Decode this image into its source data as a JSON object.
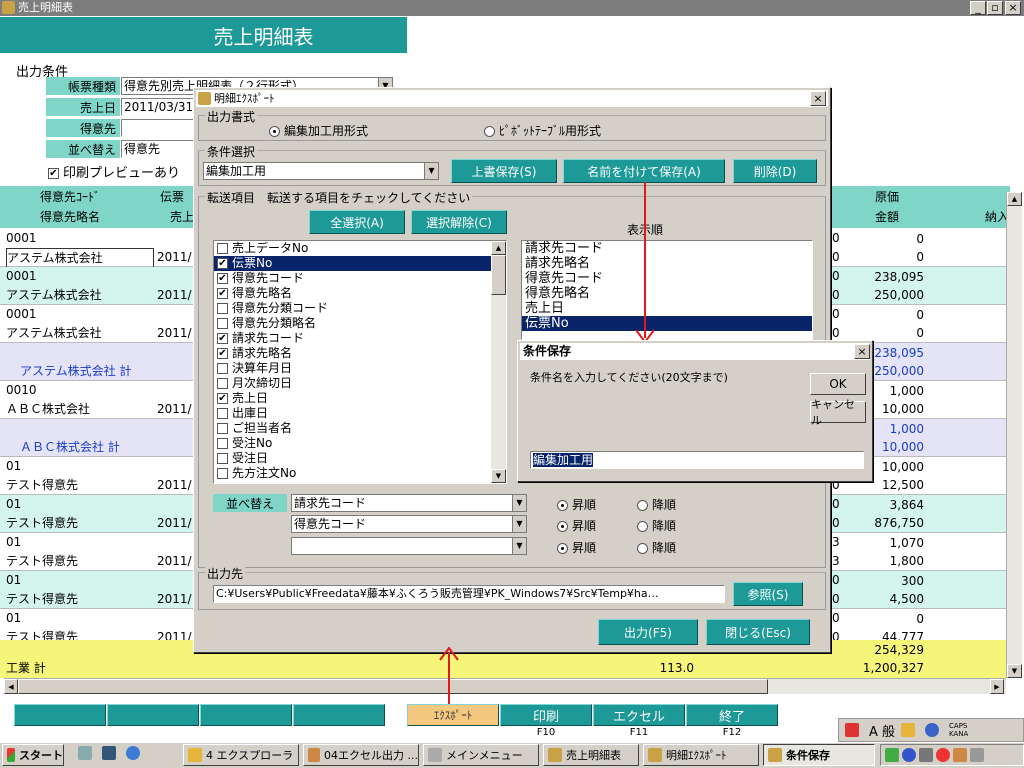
{
  "app": {
    "title": "売上明細表",
    "header": "売上明細表",
    "win_min": "_",
    "win_max": "▫",
    "win_close": "×"
  },
  "conditions": {
    "section": "出力条件",
    "report_type_label": "帳票種類",
    "report_type_value": "得意先別売上明細表（２行形式）",
    "sales_date_label": "売上日",
    "sales_date_value": "2011/03/31",
    "customer_label": "得意先",
    "customer_value": "",
    "sort_label": "並べ替え",
    "sort_value": "得意先",
    "preview_label": "印刷プレビューあり"
  },
  "grid": {
    "headers_top": [
      "得意先ｺｰﾄﾞ",
      "伝票",
      "原価",
      ""
    ],
    "headers_bottom": [
      "得意先略名",
      "売上",
      "金額",
      "納入"
    ],
    "rows": [
      {
        "code": "0001",
        "name": "アステム株式会社",
        "date": "2011/",
        "c": "0",
        "cost": "0",
        "amount": "0",
        "kind": "white"
      },
      {
        "code": "0001",
        "name": "アステム株式会社",
        "date": "2011/",
        "c": "0",
        "cost": "238,095",
        "amount": "250,000",
        "kind": "teal"
      },
      {
        "code": "0001",
        "name": "アステム株式会社",
        "date": "2011/",
        "c": "0",
        "cost": "0",
        "amount": "0",
        "kind": "white"
      },
      {
        "code": "",
        "name": "アステム株式会社 計",
        "date": "",
        "c": "",
        "cost": "238,095",
        "amount": "250,000",
        "kind": "subtotal"
      },
      {
        "code": "0010",
        "name": "ＡＢＣ株式会社",
        "date": "2011/",
        "c": "0",
        "cost": "1,000",
        "amount": "10,000",
        "kind": "white"
      },
      {
        "code": "",
        "name": "ＡＢＣ株式会社 計",
        "date": "",
        "c": "",
        "cost": "1,000",
        "amount": "10,000",
        "kind": "subtotal"
      },
      {
        "code": "01",
        "name": "テスト得意先",
        "date": "2011/",
        "c": "0",
        "cost": "10,000",
        "amount": "12,500",
        "kind": "white"
      },
      {
        "code": "01",
        "name": "テスト得意先",
        "date": "2011/",
        "c": "0",
        "cost": "3,864",
        "amount": "876,750",
        "kind": "teal"
      },
      {
        "code": "01",
        "name": "テスト得意先",
        "date": "2011/",
        "c": "3",
        "cost": "1,070",
        "amount": "1,800",
        "kind": "white"
      },
      {
        "code": "01",
        "name": "テスト得意先",
        "date": "2011/",
        "c": "0",
        "cost": "300",
        "amount": "4,500",
        "kind": "teal"
      },
      {
        "code": "01",
        "name": "テスト得意先",
        "date": "2011/",
        "c": "0",
        "cost": "0",
        "amount": "44,777",
        "kind": "white"
      }
    ],
    "total_label": "工業 計",
    "total_qty": "113.0",
    "total_cost": "254,329",
    "total_amount": "1,200,327"
  },
  "export_dialog": {
    "title": "明細ｴｸｽﾎﾟｰﾄ",
    "format_group": "出力書式",
    "format_opt1": "編集加工用形式",
    "format_opt2": "ﾋﾟﾎﾞｯﾄﾃｰﾌﾞﾙ用形式",
    "cond_group": "条件選択",
    "cond_value": "編集加工用",
    "overwrite_btn": "上書保存(S)",
    "saveas_btn": "名前を付けて保存(A)",
    "delete_btn": "削除(D)",
    "items_group": "転送項目　転送する項目をチェックしてください",
    "select_all_btn": "全選択(A)",
    "deselect_btn": "選択解除(C)",
    "display_order_label": "表示順",
    "items": [
      {
        "label": "売上データNo",
        "checked": false
      },
      {
        "label": "伝票No",
        "checked": true
      },
      {
        "label": "得意先コード",
        "checked": true
      },
      {
        "label": "得意先略名",
        "checked": true
      },
      {
        "label": "得意先分類コード",
        "checked": false
      },
      {
        "label": "得意先分類略名",
        "checked": false
      },
      {
        "label": "請求先コード",
        "checked": true
      },
      {
        "label": "請求先略名",
        "checked": true
      },
      {
        "label": "決算年月日",
        "checked": false
      },
      {
        "label": "月次締切日",
        "checked": false
      },
      {
        "label": "売上日",
        "checked": true
      },
      {
        "label": "出庫日",
        "checked": false
      },
      {
        "label": "ご担当者名",
        "checked": false
      },
      {
        "label": "受注No",
        "checked": false
      },
      {
        "label": "受注日",
        "checked": false
      },
      {
        "label": "先方注文No",
        "checked": false
      }
    ],
    "order_items": [
      "請求先コード",
      "請求先略名",
      "得意先コード",
      "得意先略名",
      "売上日",
      "伝票No"
    ],
    "sort_label": "並べ替え",
    "sort1": "請求先コード",
    "sort2": "得意先コード",
    "sort3": "",
    "asc": "昇順",
    "desc": "降順",
    "output_group": "出力先",
    "output_path": "C:¥Users¥Public¥Freedata¥藤本¥ふくろう販売管理¥PK_Windows7¥Src¥Temp¥ha…",
    "browse_btn": "参照(S)",
    "output_btn": "出力(F5)",
    "close_btn": "閉じる(Esc)"
  },
  "save_dialog": {
    "title": "条件保存",
    "prompt": "条件名を入力してください(20文字まで)",
    "ok": "OK",
    "cancel": "キャンセル",
    "input_value": "編集加工用"
  },
  "fkeys": [
    {
      "label": "",
      "key": ""
    },
    {
      "label": "",
      "key": ""
    },
    {
      "label": "",
      "key": ""
    },
    {
      "label": "",
      "key": ""
    },
    {
      "label": "ｴｸｽﾎﾟｰﾄ",
      "key": ""
    },
    {
      "label": "印刷",
      "key": "F10"
    },
    {
      "label": "エクセル",
      "key": "F11"
    },
    {
      "label": "終了",
      "key": "F12"
    }
  ],
  "ime": {
    "mode": "A 般",
    "caps": "CAPS",
    "kana": "KANA"
  },
  "taskbar": {
    "start": "スタート",
    "items": [
      "4 エクスプローラ",
      "04エクセル出力 ...",
      "メインメニュー",
      "売上明細表",
      "明細ｴｸｽﾎﾟｰﾄ",
      "条件保存"
    ]
  },
  "colors": {
    "teal": "#1d9a98",
    "titlebar": "#7d7d7d",
    "highlight": "#0a246a",
    "arrow": "#e01a1a"
  }
}
